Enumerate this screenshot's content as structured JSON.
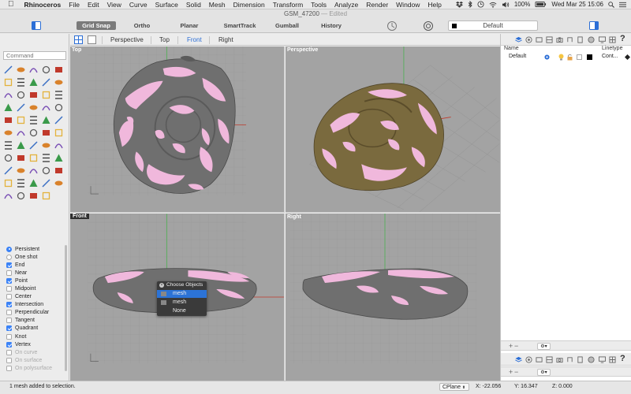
{
  "menubar": {
    "apple": "",
    "app_name": "Rhinoceros",
    "items": [
      "File",
      "Edit",
      "View",
      "Curve",
      "Surface",
      "Solid",
      "Mesh",
      "Dimension",
      "Transform",
      "Tools",
      "Analyze",
      "Render",
      "Window",
      "Help"
    ],
    "battery": "100%",
    "clock": "Wed Mar 25  15:06"
  },
  "window": {
    "title": "GSM_47200",
    "status": "— Edited"
  },
  "toolbar": {
    "modes": [
      {
        "label": "Grid Snap",
        "active": true
      },
      {
        "label": "Ortho",
        "active": false
      },
      {
        "label": "Planar",
        "active": false
      },
      {
        "label": "SmartTrack",
        "active": false
      },
      {
        "label": "Gumball",
        "active": false
      },
      {
        "label": "History",
        "active": false
      }
    ],
    "current_layer": "Default"
  },
  "command": {
    "placeholder": "Command"
  },
  "osnap": {
    "mode_options": [
      {
        "label": "Persistent",
        "selected": true
      },
      {
        "label": "One shot",
        "selected": false
      }
    ],
    "snaps": [
      {
        "label": "End",
        "checked": true,
        "enabled": true
      },
      {
        "label": "Near",
        "checked": false,
        "enabled": true
      },
      {
        "label": "Point",
        "checked": true,
        "enabled": true
      },
      {
        "label": "Midpoint",
        "checked": false,
        "enabled": true
      },
      {
        "label": "Center",
        "checked": false,
        "enabled": true
      },
      {
        "label": "Intersection",
        "checked": true,
        "enabled": true
      },
      {
        "label": "Perpendicular",
        "checked": false,
        "enabled": true
      },
      {
        "label": "Tangent",
        "checked": false,
        "enabled": true
      },
      {
        "label": "Quadrant",
        "checked": true,
        "enabled": true
      },
      {
        "label": "Knot",
        "checked": false,
        "enabled": true
      },
      {
        "label": "Vertex",
        "checked": true,
        "enabled": true
      },
      {
        "label": "On curve",
        "checked": false,
        "enabled": false
      },
      {
        "label": "On surface",
        "checked": false,
        "enabled": false
      },
      {
        "label": "On polysurface",
        "checked": false,
        "enabled": false
      }
    ]
  },
  "viewport_tabs": [
    {
      "label": "Perspective",
      "active": false
    },
    {
      "label": "Top",
      "active": false
    },
    {
      "label": "Front",
      "active": true
    },
    {
      "label": "Right",
      "active": false
    }
  ],
  "viewports": {
    "top": "Top",
    "perspective": "Perspective",
    "front": "Front",
    "right": "Right"
  },
  "choose_objects": {
    "title": "Choose Objects",
    "items": [
      {
        "label": "mesh",
        "selected": true
      },
      {
        "label": "mesh",
        "selected": false
      },
      {
        "label": "None",
        "selected": false
      }
    ]
  },
  "layers": {
    "columns": {
      "name": "Name",
      "linetype": "Linetype"
    },
    "rows": [
      {
        "name": "Default",
        "linetype": "Cont..."
      }
    ]
  },
  "statusbar": {
    "message": "1 mesh added to selection.",
    "cplane": "CPlane",
    "x": "X: -22.056",
    "y": "Y: 16.347",
    "z": "Z: 0.000"
  },
  "colors": {
    "accent": "#2b6ed6",
    "selection_pink": "#f0b8dc",
    "mesh_gray": "#6e6e6e",
    "mesh_render": "#7a6a3e",
    "viewport_bg": "#a3a3a3"
  }
}
